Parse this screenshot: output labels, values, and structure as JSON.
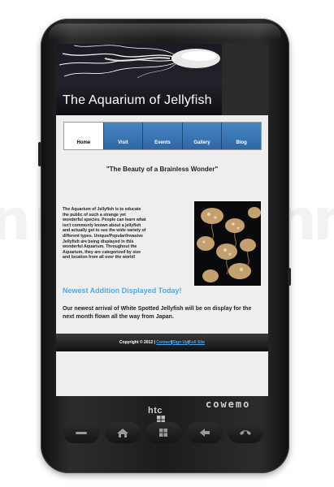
{
  "watermark": {
    "text": "..."
  },
  "phone": {
    "brand": "htc",
    "logo": "cowemo",
    "buttons": [
      "call-icon",
      "home-icon",
      "windows-icon",
      "back-icon",
      "end-call-icon"
    ]
  },
  "site": {
    "title": "The Aquarium of Jellyfish",
    "nav": [
      {
        "label": "Home",
        "active": true
      },
      {
        "label": "Visit",
        "active": false
      },
      {
        "label": "Events",
        "active": false
      },
      {
        "label": "Gallery",
        "active": false
      },
      {
        "label": "Blog",
        "active": false
      }
    ],
    "tagline": "\"The Beauty of a Brainless Wonder\"",
    "intro": "The Aquarium of Jellyfish is to educate the public of such a strange yet wonderful species. People can learn what isn't commonly known about a jellyfish and actually get to see the wide variety of different types. Unique/Popular/Invasive Jellyfish are being displayed in this wonderful Aquarium. Throughout the Aquarium, they are categorized by size and location from all over the world!",
    "newest_heading": "Newest Addition Displayed Today!",
    "arrival_text": "Our newest arrival of White Spotted Jellyfish will be on display for the next month flown all the way from Japan.",
    "footer": {
      "copyright": "Copyright © 2012 |",
      "contact": "Contact",
      "sep1": " | ",
      "signup": "Sign Up",
      "sep2": " | ",
      "fullsite": "Full Site"
    }
  },
  "colors": {
    "nav_blue": "#3a74b4",
    "accent_text": "#5aa6dc",
    "footer_link": "#4ea4e8"
  }
}
